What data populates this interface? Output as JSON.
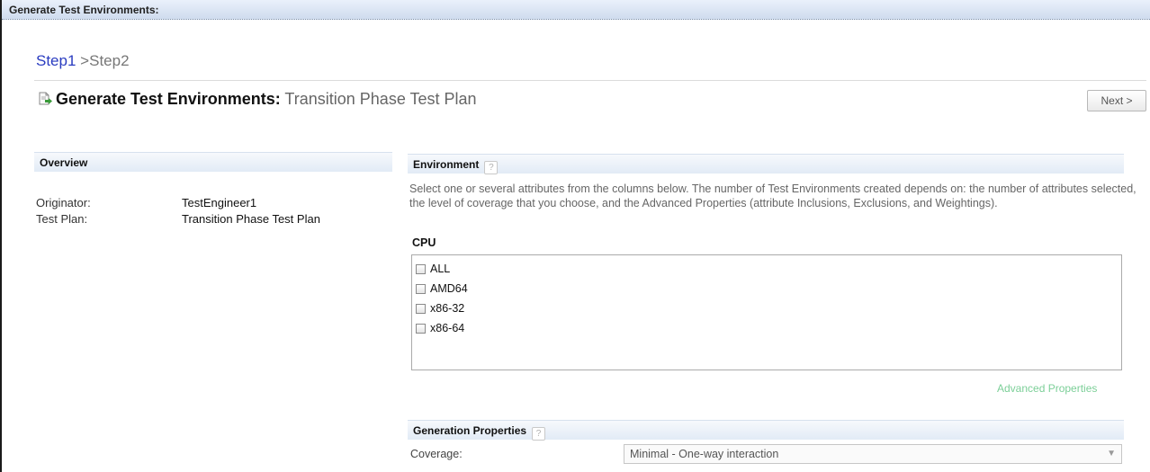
{
  "window": {
    "title": "Generate Test Environments:"
  },
  "breadcrumb": {
    "step1": "Step1",
    "separator": ">",
    "step2": "Step2"
  },
  "header": {
    "title_bold": "Generate Test Environments:",
    "title_sub": "Transition Phase Test Plan",
    "next_label": "Next >"
  },
  "overview": {
    "heading": "Overview",
    "rows": [
      {
        "label": "Originator:",
        "value": "TestEngineer1"
      },
      {
        "label": "Test Plan:",
        "value": "Transition Phase Test Plan"
      }
    ]
  },
  "environment": {
    "heading": "Environment",
    "help": "?",
    "description": "Select one or several attributes from the columns below. The number of Test Environments created depends on: the number of attributes selected, the level of coverage that you choose, and the Advanced Properties (attribute Inclusions, Exclusions, and Weightings).",
    "cpu_label": "CPU",
    "cpu_options": [
      "ALL",
      "AMD64",
      "x86-32",
      "x86-64"
    ],
    "advanced_link": "Advanced Properties"
  },
  "generation": {
    "heading": "Generation Properties",
    "help": "?",
    "coverage_label": "Coverage:",
    "coverage_value": "Minimal - One-way interaction"
  },
  "colors": {
    "link": "#2a3cc0",
    "advanced_link": "#7ccf98",
    "header_bg": "#e2ebf6"
  },
  "icons": {
    "document": "document-arrow-icon",
    "help": "help-icon",
    "dropdown": "chevron-down-icon"
  }
}
